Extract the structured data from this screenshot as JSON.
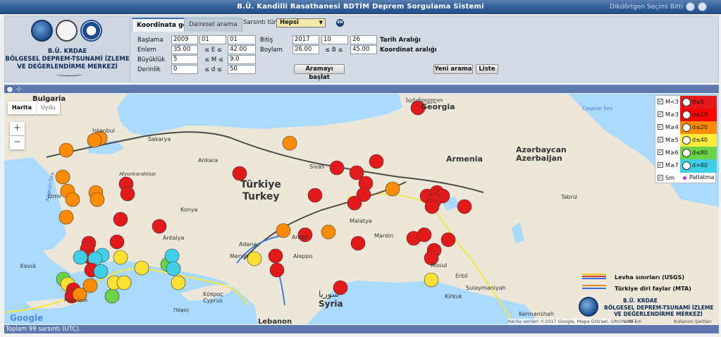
{
  "window": {
    "title": "B.Ü. Kandilli Rasathanesi BDTİM Deprem Sorgulama Sistemi",
    "right_text": "Dikdörtgen Seçimi Bitti"
  },
  "institution": {
    "line1": "B.Ü. KRDAE",
    "line2": "BÖLGESEL DEPREM-TSUNAMİ İZLEME",
    "line3": "VE DEĞERLENDİRME MERKEZİ"
  },
  "tabs": [
    {
      "label": "Koordinata göre",
      "active": true
    },
    {
      "label": "Dairesel arama",
      "active": false
    }
  ],
  "filter": {
    "label": "Sarsıntı türü",
    "value": "Hepsi",
    "lang_badge": "EN"
  },
  "form": {
    "baslama": {
      "label": "Başlama",
      "year": "2009",
      "month": "01",
      "day": "01"
    },
    "bitis": {
      "label": "Bitiş",
      "year": "2017",
      "month": "10",
      "day": "26"
    },
    "tarih_label": "Tarih Aralığı",
    "enlem": {
      "label": "Enlem",
      "min": "35.00",
      "op": "≤ E ≤",
      "max": "42.00"
    },
    "boylam": {
      "label": "Boylam",
      "min": "26.00",
      "op": "≤ B ≤",
      "max": "45.00"
    },
    "koordinat_label": "Koordinat aralığı",
    "buyukluk": {
      "label": "Büyüklük",
      "min": "5",
      "op": "≤ M ≤",
      "max": "9.0"
    },
    "derinlik": {
      "label": "Derinlik",
      "min": "0",
      "op": "≤ d ≤",
      "max": "50"
    }
  },
  "buttons": {
    "start": "Aramayı başlat",
    "new": "Yeni arama",
    "list": "Liste"
  },
  "map": {
    "type_buttons": [
      "Harita",
      "Uydu"
    ],
    "zoom_in": "+",
    "zoom_out": "−",
    "labels": {
      "bulgaria": "Bulgaria",
      "istanbul": "İstanbul",
      "sakarya": "Sakarya",
      "ankara": "Ankara",
      "sivas": "Sivas",
      "turkiye": "Türkiye",
      "turkey": "Turkey",
      "adana": "Adana",
      "mersin": "Mersin",
      "antalya": "Antalya",
      "aleppo": "Aleppo",
      "syria": "Syria",
      "syria_ar": "سوريا",
      "cyprus": "Cyprus",
      "cyprus_gr": "Κύπρος",
      "lebanon": "Lebanon",
      "georgia": "Georgia",
      "georgia_ka": "საქართველო",
      "armenia": "Armenia",
      "azerbaijan_1": "Azərbaycan",
      "azerbaijan_2": "Azerbaijan",
      "tabriz": "Tabriz",
      "mosul": "Mosul",
      "erbil": "Erbil",
      "kirkuk": "Kirkuk",
      "sulaymaniyah": "Sulaymaniyah",
      "kermanshah": "Kermanshah",
      "caspian": "Caspian Sea",
      "aegean": "Aegean Sea",
      "malatya": "Malatya",
      "mardin": "Mardin",
      "antep": "Antep",
      "izmir": "İzmir",
      "afyon": "Afyonkarahisar",
      "konya": "Konya",
      "chania": "Χανιά",
      "heraklion": "Ηράκλειο",
      "paphos": "Πάφος"
    },
    "overlay_legend": {
      "plates": "Levha sınırları (USGS)",
      "faults": "Türkiye diri faylar (MTA)",
      "inst1": "B.Ü. KRDAE",
      "inst2": "BÖLGESEL DEPREM-TSUNAMİ İZLEME",
      "inst3": "VE DEĞERLENDİRME MERKEZİ"
    },
    "google": "Google",
    "attribution": "Harita verileri ©2017 Google, Mapa GISrael, ORION-ME",
    "scale": "100 km",
    "terms": "Kullanım Şartları"
  },
  "legend": {
    "magnitudes": [
      "M<3",
      "M≥3",
      "M≥4",
      "M≥5",
      "M≥6",
      "M≥7"
    ],
    "depths": [
      {
        "label": "d≤5",
        "color": "#e31a1c"
      },
      {
        "label": "d≤10",
        "color": "#ff0000"
      },
      {
        "label": "d≤20",
        "color": "#ff8c00"
      },
      {
        "label": "d≤40",
        "color": "#ffeb3b"
      },
      {
        "label": "d≤80",
        "color": "#6ad34a"
      },
      {
        "label": "d>80",
        "color": "#3fd0e8"
      }
    ],
    "sm": "Sm",
    "patlatma": "Patlatma"
  },
  "status": "Toplam 99 sarsıntı (UTC)."
}
